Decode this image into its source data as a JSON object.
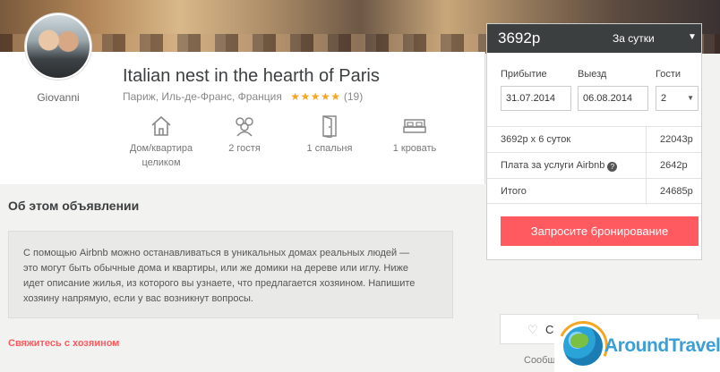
{
  "listing": {
    "title": "Italian nest in the hearth of Paris",
    "location": "Париж, Иль-де-Франс, Франция",
    "stars": "★★★★★",
    "reviews": "(19)",
    "host_name": "Giovanni",
    "amenities": [
      {
        "icon": "house-icon",
        "line1": "Дом/квартира",
        "line2": "целиком"
      },
      {
        "icon": "guests-icon",
        "line1": "2 гостя",
        "line2": ""
      },
      {
        "icon": "door-icon",
        "line1": "1 спальня",
        "line2": ""
      },
      {
        "icon": "bed-icon",
        "line1": "1 кровать",
        "line2": ""
      }
    ]
  },
  "about": {
    "title": "Об этом объявлении",
    "description_lines": [
      "С помощью Airbnb можно останавливаться в уникальных домах реальных людей —",
      "это могут быть обычные дома и квартиры, или же домики на дереве или иглу. Ниже",
      "идет описание жилья, из которого вы узнаете, что предлагается хозяином. Напишите",
      "хозяину напрямую, если у вас возникнут вопросы."
    ],
    "contact_link": "Свяжитесь с хозяином"
  },
  "booking": {
    "price": "3692р",
    "period": "За сутки",
    "checkin_label": "Прибытие",
    "checkout_label": "Выезд",
    "guests_label": "Гости",
    "checkin_value": "31.07.2014",
    "checkout_value": "06.08.2014",
    "guests_value": "2",
    "rows": [
      {
        "label": "3692р x 6 суток",
        "value": "22043р"
      },
      {
        "label": "Плата за услуги Airbnb",
        "value": "2642р"
      },
      {
        "label": "Итого",
        "value": "24685р"
      }
    ],
    "help_glyph": "?",
    "book_button": "Запросите бронирование"
  },
  "save": {
    "label": "Со",
    "share_text": "Сообщ"
  },
  "watermark": {
    "text": "AroundTravels"
  },
  "colors": {
    "accent": "#ff5a5f",
    "header_dark": "#3c3f40",
    "star": "#f5a623"
  }
}
